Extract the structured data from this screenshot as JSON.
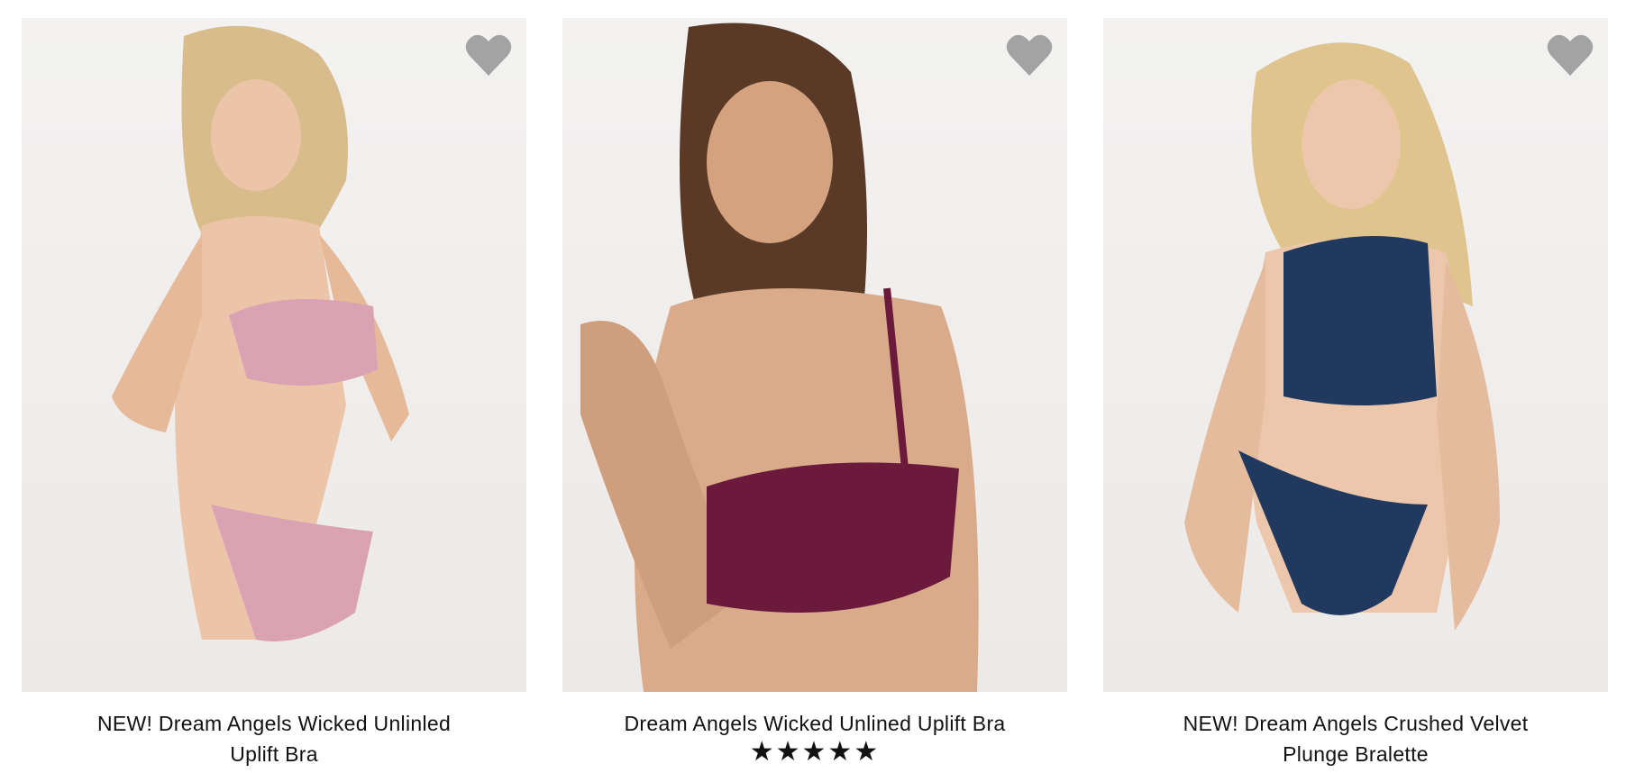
{
  "products": [
    {
      "name": "NEW! Dream Angels Wicked Unlinled Uplift Bra",
      "rating_stars": "★★★★★",
      "image_alt": "Model wearing pink lace bra and panty",
      "garment_color": "#d9a3b3"
    },
    {
      "name": "Dream Angels Wicked Unlined Uplift Bra",
      "rating_stars": "★★★★★",
      "image_alt": "Model wearing burgundy lace bra",
      "garment_color": "#6b1a3c"
    },
    {
      "name": "NEW! Dream Angels Crushed Velvet Plunge Bralette",
      "rating_stars": "★★★★★",
      "image_alt": "Model wearing navy crushed velvet bralette and panty",
      "garment_color": "#22395f"
    }
  ],
  "icons": {
    "favorite": "heart-icon"
  },
  "colors": {
    "heart": "#a3a3a3",
    "skin": "#e8bfa3",
    "background": "#f1f0ef"
  }
}
